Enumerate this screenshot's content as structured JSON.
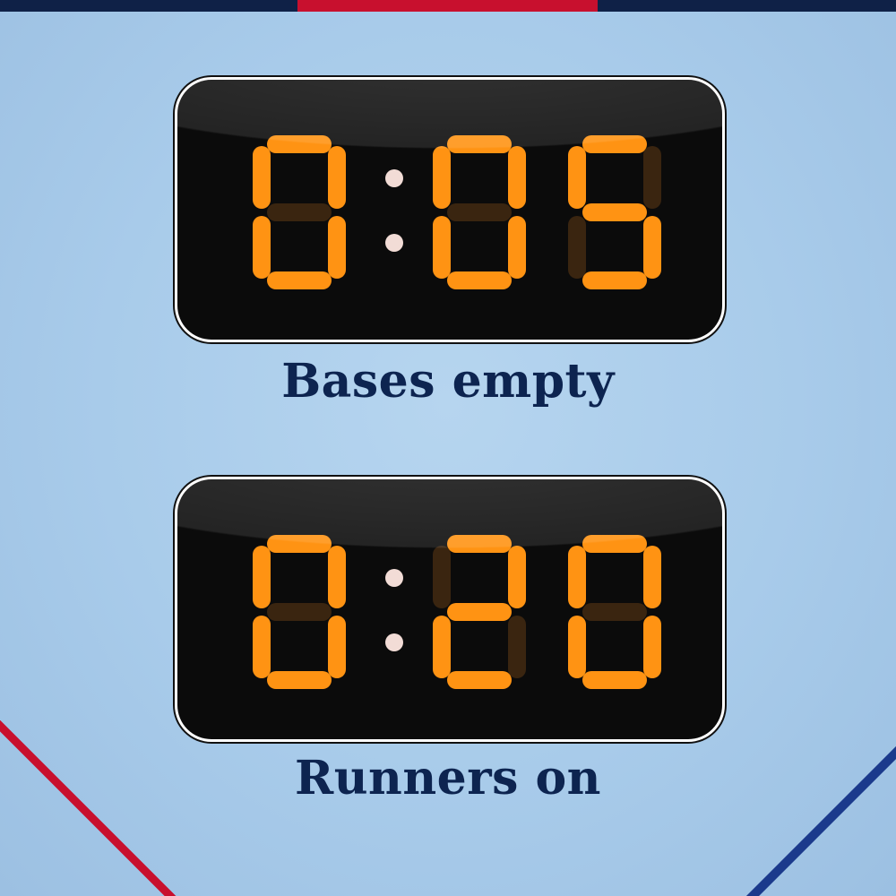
{
  "colors": {
    "background": "#a8cbea",
    "navy": "#0f2147",
    "red": "#c8102e",
    "segment_on": "#ff9313",
    "segment_off": "#3a2510",
    "label": "#0d2450"
  },
  "clocks": [
    {
      "time": "0:05",
      "label": "Bases empty"
    },
    {
      "time": "0:20",
      "label": "Runners on"
    }
  ]
}
